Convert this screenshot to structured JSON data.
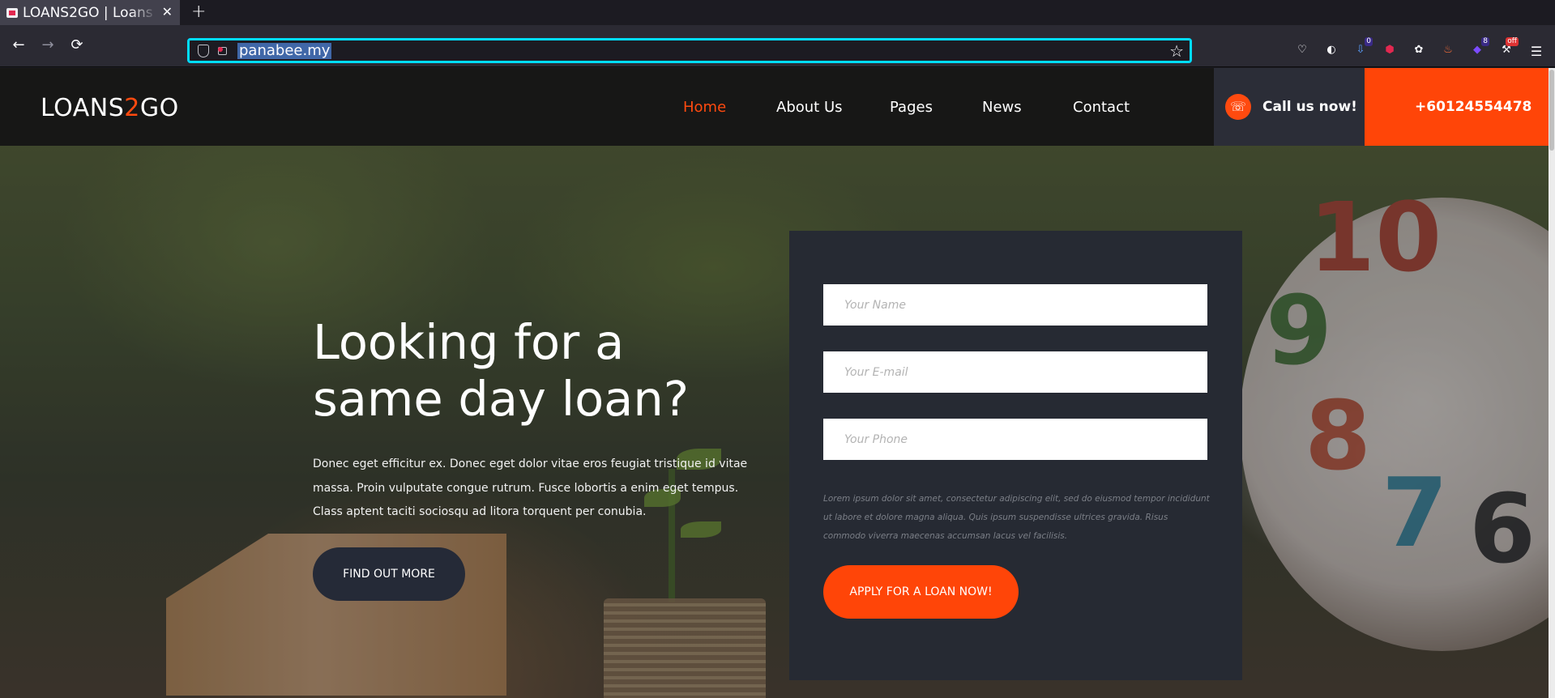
{
  "browser": {
    "tab_title": "LOANS2GO | Loans",
    "tab_close": "✕",
    "new_tab": "+",
    "url": "panabee.my",
    "back": "←",
    "forward": "→",
    "reload": "⟳",
    "star": "☆",
    "extensions": [
      {
        "icon": "pocket-icon",
        "glyph": "♡"
      },
      {
        "icon": "privacy-icon",
        "glyph": "◐"
      },
      {
        "icon": "download-icon",
        "glyph": "⇩",
        "badge": "0"
      },
      {
        "icon": "ublock-icon",
        "glyph": "⬢"
      },
      {
        "icon": "cookie-icon",
        "glyph": "✿"
      },
      {
        "icon": "fire-icon",
        "glyph": "♨"
      },
      {
        "icon": "extension-badge-icon",
        "glyph": "◆",
        "badge": "8"
      },
      {
        "icon": "tools-icon",
        "glyph": "⚒",
        "badge": "off"
      }
    ],
    "menu": "☰"
  },
  "site": {
    "logo": {
      "part1": "LOANS",
      "accent": "2",
      "part2": "GO"
    },
    "nav": [
      {
        "label": "Home",
        "active": true
      },
      {
        "label": "About Us",
        "active": false
      },
      {
        "label": "Pages",
        "active": false
      },
      {
        "label": "News",
        "active": false
      },
      {
        "label": "Contact",
        "active": false
      }
    ],
    "call": {
      "label": "Call us now!",
      "phone": "+60124554478",
      "icon": "☏"
    },
    "hero": {
      "headline_line1": "Looking for a",
      "headline_line2": "same day loan?",
      "lead": "Donec eget efficitur ex. Donec eget dolor vitae eros feugiat tristique id vitae massa. Proin vulputate congue rutrum. Fusce lobortis a enim eget tempus. Class aptent taciti sociosqu ad litora torquent per conubia.",
      "cta": "FIND OUT MORE"
    },
    "form": {
      "name_placeholder": "Your Name",
      "email_placeholder": "Your E-mail",
      "phone_placeholder": "Your Phone",
      "disclaimer": "Lorem ipsum dolor sit amet, consectetur adipiscing elit, sed do eiusmod tempor incididunt ut labore et dolore magna aliqua. Quis ipsum suspendisse ultrices gravida. Risus commodo viverra maecenas accumsan lacus vel facilisis.",
      "submit": "APPLY FOR A LOAN NOW!"
    },
    "clock_numbers": [
      "10",
      "9",
      "8",
      "7",
      "6"
    ],
    "colors": {
      "accent": "#ff4508",
      "panel": "#262a33",
      "header": "#171716"
    }
  }
}
